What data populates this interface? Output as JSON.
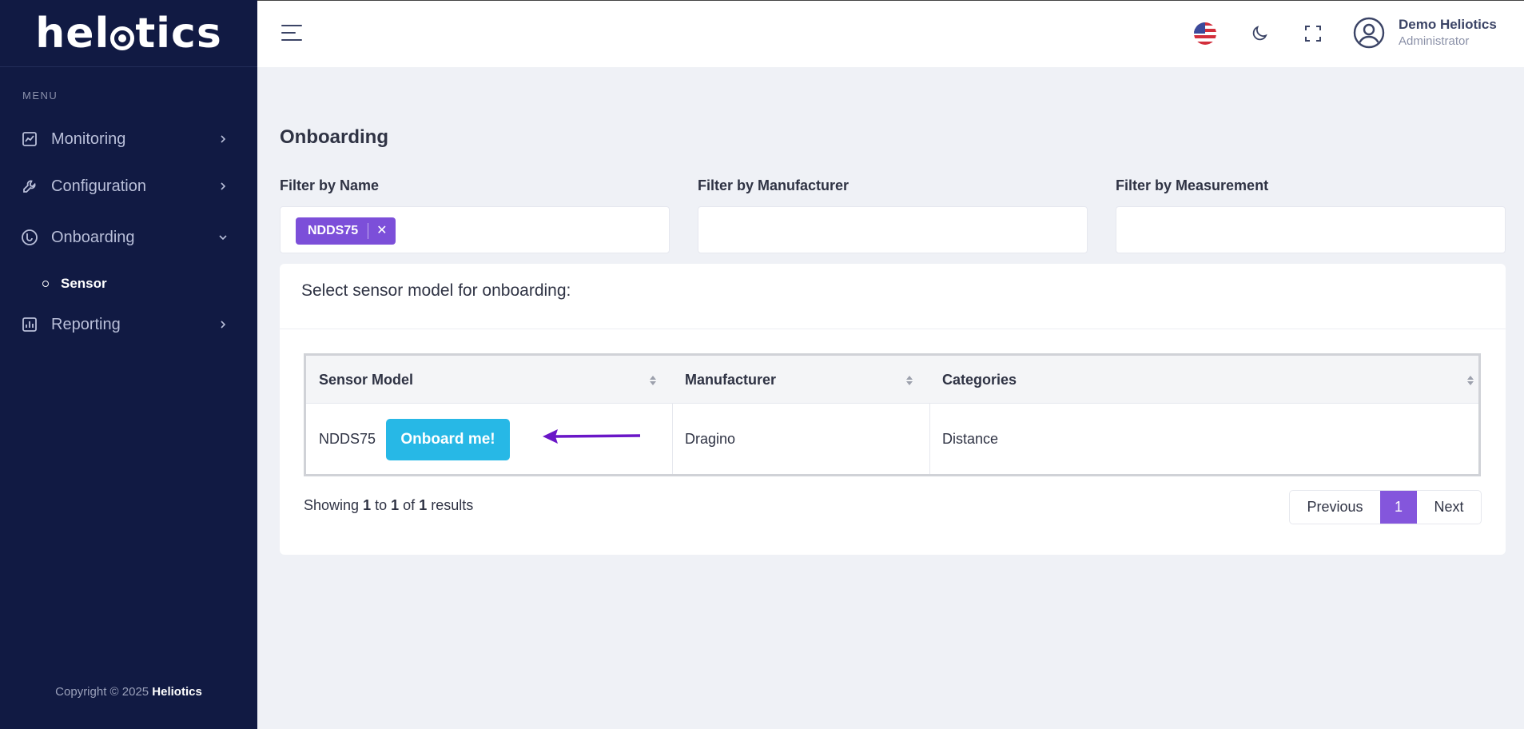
{
  "brand": {
    "logo_part1": "hel",
    "logo_part2": "tics",
    "logo_name": "heliotics"
  },
  "sidebar": {
    "menu_label": "MENU",
    "items": [
      {
        "label": "Monitoring",
        "icon": "chart-icon"
      },
      {
        "label": "Configuration",
        "icon": "wrench-icon"
      },
      {
        "label": "Onboarding",
        "icon": "onboarding-icon",
        "expanded": true
      },
      {
        "label": "Reporting",
        "icon": "bar-chart-icon"
      }
    ],
    "sub_items": [
      {
        "label": "Sensor",
        "active": true
      }
    ],
    "copyright_prefix": "Copyright © 2025",
    "copyright_brand": "Heliotics"
  },
  "header": {
    "user_name": "Demo Heliotics",
    "user_role": "Administrator"
  },
  "main": {
    "title": "Onboarding",
    "filters": [
      {
        "label": "Filter by Name",
        "tags": [
          "NDDS75"
        ]
      },
      {
        "label": "Filter by Manufacturer",
        "tags": []
      },
      {
        "label": "Filter by Measurement",
        "tags": []
      }
    ],
    "card_title": "Select sensor model for onboarding:",
    "table": {
      "columns": [
        "Sensor Model",
        "Manufacturer",
        "Categories"
      ],
      "rows": [
        {
          "model": "NDDS75",
          "action": "Onboard me!",
          "manufacturer": "Dragino",
          "categories": "Distance"
        }
      ]
    },
    "pagination_info": {
      "prefix": "Showing",
      "from": "1",
      "to_word": "to",
      "to": "1",
      "of_word": "of",
      "total": "1",
      "suffix": "results"
    },
    "pagination": {
      "previous": "Previous",
      "current": "1",
      "next": "Next"
    }
  },
  "colors": {
    "sidebar_bg": "#111a43",
    "accent_purple": "#7c4fd9",
    "button_cyan": "#27b8e6",
    "arrow": "#6a16c7"
  }
}
